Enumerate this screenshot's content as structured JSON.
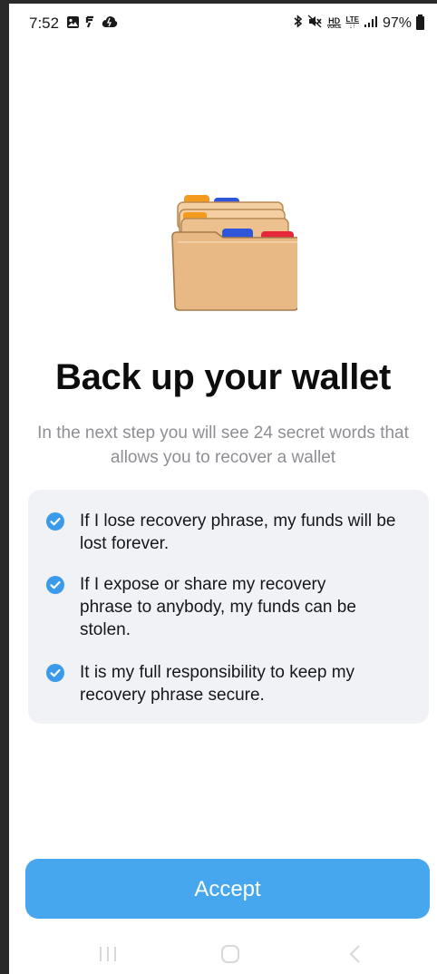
{
  "status_bar": {
    "time": "7:52",
    "battery": "97%",
    "network": {
      "hd": "HD",
      "voice": "VOICE",
      "lte": "LTE"
    },
    "left_icons": [
      "gallery-icon",
      "wireless-charging-icon",
      "cloud-icon"
    ],
    "right_icons": [
      "bluetooth-icon",
      "mute-icon",
      "hd-voice-icon",
      "lte-icon",
      "signal-icon",
      "battery-icon"
    ]
  },
  "illustration": {
    "icon": "file-folders-icon"
  },
  "title": "Back up your wallet",
  "subtitle": "In the next step you will see 24 secret words that allows you to recover a wallet",
  "checklist": [
    {
      "text": "If I lose recovery phrase, my funds will be lost forever.",
      "checked": true
    },
    {
      "text": "If I expose or share my recovery phrase to anybody, my funds can be stolen.",
      "checked": true
    },
    {
      "text": "It is my full responsibility to keep my recovery phrase secure.",
      "checked": true
    }
  ],
  "accept_button": {
    "label": "Accept"
  },
  "colors": {
    "accent": "#46a7ef",
    "check": "#3b9bea",
    "card_bg": "#f1f2f5",
    "subtitle": "#8d8f94"
  },
  "nav": {
    "icons": [
      "recents-icon",
      "home-icon",
      "back-icon"
    ]
  }
}
